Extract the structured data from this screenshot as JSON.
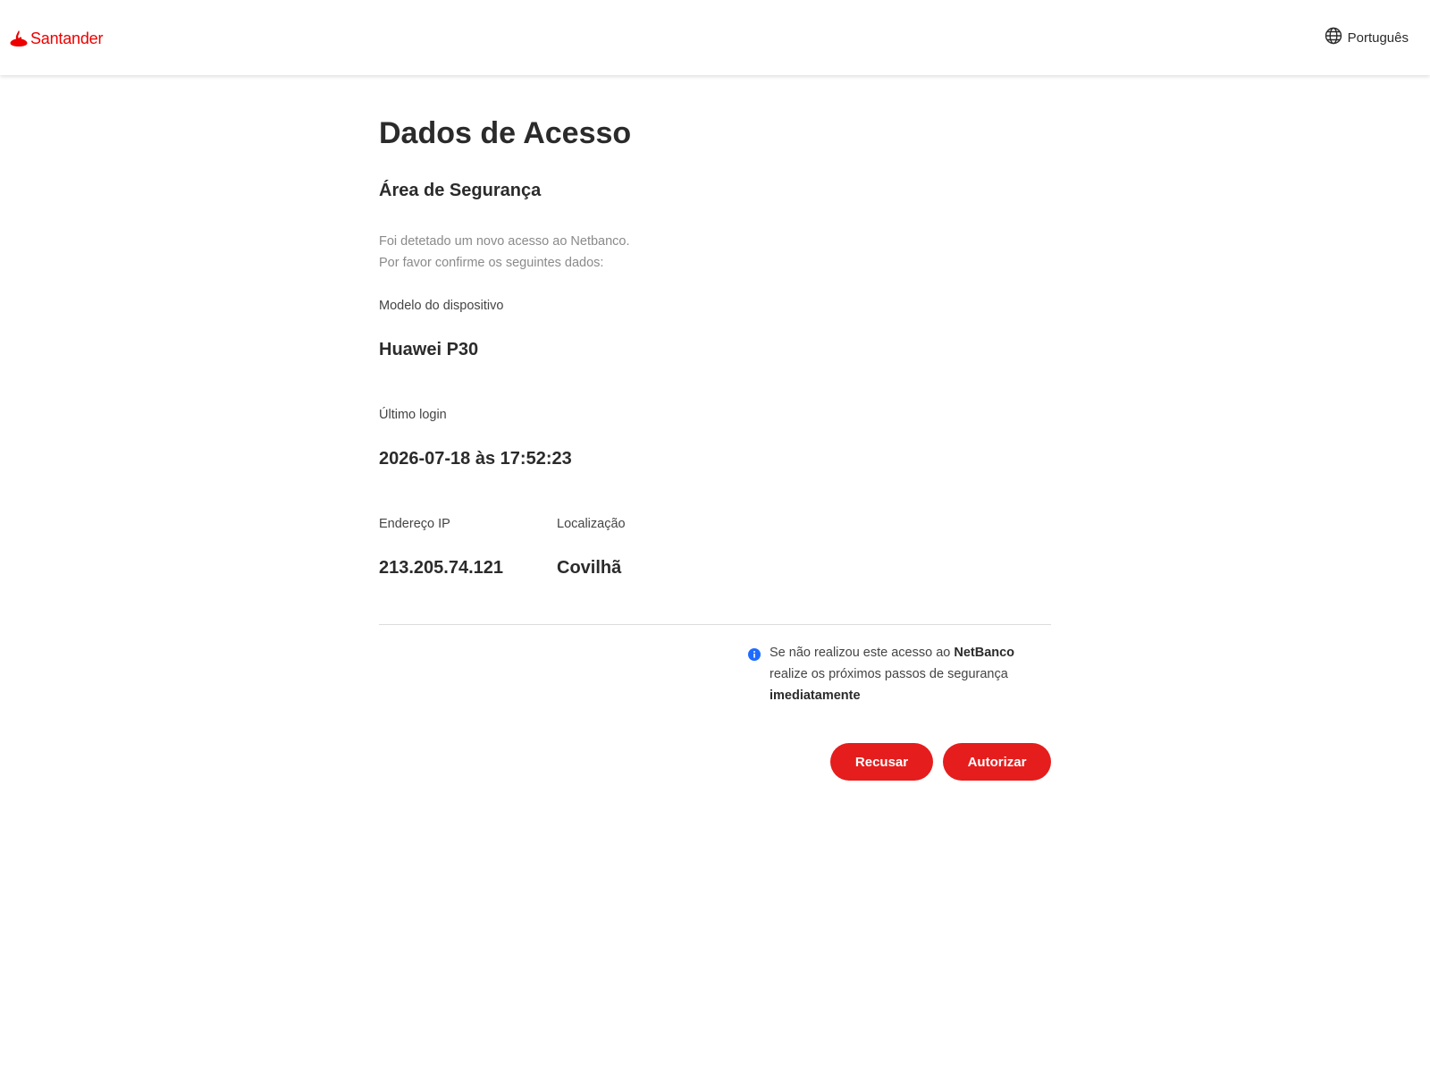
{
  "header": {
    "logo_text": "Santander",
    "logo_icon": "santander-flame-icon",
    "language_icon": "globe-icon",
    "language_label": "Português"
  },
  "main": {
    "title": "Dados de Acesso",
    "section_title": "Área de Segurança",
    "intro_line1": "Foi detetado um novo acesso ao Netbanco.",
    "intro_line2": "Por favor confirme os seguintes dados:",
    "device_label": "Modelo do dispositivo",
    "device_value": "Huawei P30",
    "last_login_label": "Último login",
    "last_login_value": "2026-07-18 às 17:52:23",
    "ip_label": "Endereço IP",
    "ip_value": "213.205.74.121",
    "location_label": "Localização",
    "location_value": "Covilhã"
  },
  "notice": {
    "icon": "info-icon",
    "text_part1": "Se não realizou este acesso ao ",
    "text_bold1": "NetBanco",
    "text_part2": "realize os próximos passos de segurança",
    "text_bold2": "imediatamente"
  },
  "actions": {
    "refuse_label": "Recusar",
    "authorize_label": "Autorizar"
  },
  "colors": {
    "brand_red": "#ec0000",
    "button_red": "#e51d1d",
    "info_blue": "#1f6bff"
  }
}
